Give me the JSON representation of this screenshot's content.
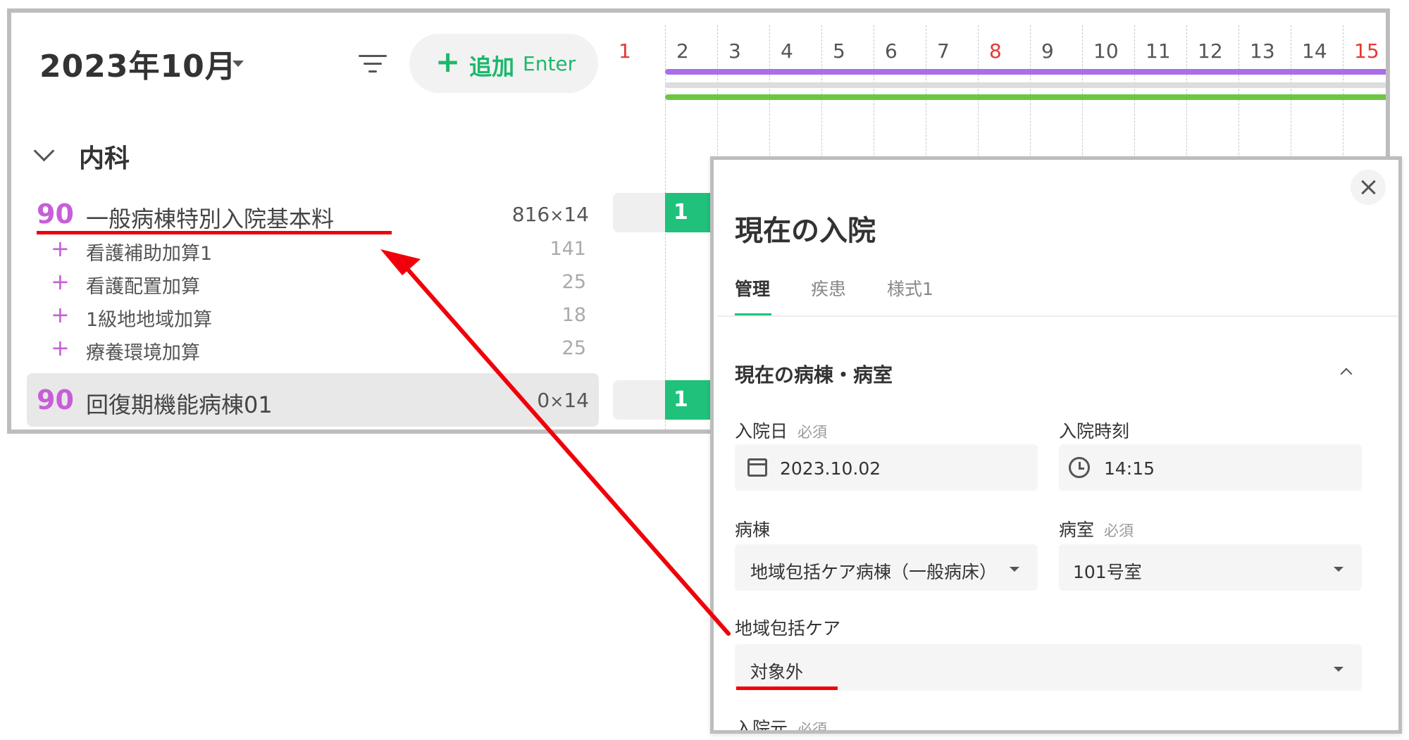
{
  "calendar": {
    "month_title": "2023年10月",
    "add_button": {
      "label": "追加",
      "shortcut": "Enter",
      "icon": "plus-icon"
    },
    "days": [
      {
        "label": "1",
        "holiday": true
      },
      {
        "label": "2",
        "holiday": false
      },
      {
        "label": "3",
        "holiday": false
      },
      {
        "label": "4",
        "holiday": false
      },
      {
        "label": "5",
        "holiday": false
      },
      {
        "label": "6",
        "holiday": false
      },
      {
        "label": "7",
        "holiday": false
      },
      {
        "label": "8",
        "holiday": true
      },
      {
        "label": "9",
        "holiday": false
      },
      {
        "label": "10",
        "holiday": false
      },
      {
        "label": "11",
        "holiday": false
      },
      {
        "label": "12",
        "holiday": false
      },
      {
        "label": "13",
        "holiday": false
      },
      {
        "label": "14",
        "holiday": false
      },
      {
        "label": "15",
        "holiday": true
      }
    ],
    "bar_colors": {
      "purple": "#a96ee8",
      "grey": "#dddddd",
      "green": "#6cc644"
    },
    "department": "内科",
    "rows": [
      {
        "number": "90",
        "name": "一般病棟特別入院基本料",
        "points": "816",
        "times": "×",
        "count": "14",
        "cell": "1",
        "additions": [
          {
            "name": "看護補助加算1",
            "points": "141"
          },
          {
            "name": "看護配置加算",
            "points": "25"
          },
          {
            "name": "1級地地域加算",
            "points": "18"
          },
          {
            "name": "療養環境加算",
            "points": "25"
          }
        ]
      },
      {
        "number": "90",
        "name": "回復期機能病棟01",
        "points": "0",
        "times": "×",
        "count": "14",
        "cell": "1"
      }
    ]
  },
  "panel": {
    "title": "現在の入院",
    "tabs": [
      "管理",
      "疾患",
      "様式1"
    ],
    "active_tab": "管理",
    "section_title": "現在の病棟・病室",
    "required_label": "必須",
    "fields": {
      "admission_date": {
        "label": "入院日",
        "value": "2023.10.02"
      },
      "admission_time": {
        "label": "入院時刻",
        "value": "14:15"
      },
      "ward": {
        "label": "病棟",
        "value": "地域包括ケア病棟（一般病床）"
      },
      "room": {
        "label": "病室",
        "value": "101号室"
      },
      "community_care": {
        "label": "地域包括ケア",
        "value": "対象外"
      },
      "admission_source": {
        "label": "入院元"
      }
    }
  },
  "accent_colors": {
    "green": "#1fc17b",
    "magenta": "#c75ed8",
    "annotation_red": "#f0000a"
  }
}
